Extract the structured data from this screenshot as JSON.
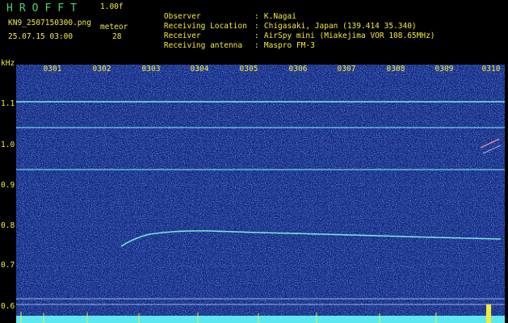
{
  "header": {
    "logo": "HROFFT",
    "version": "1.00f",
    "filename": "KN9_2507150300.png",
    "meteor_label": "meteor",
    "meteor_count": "28",
    "datetime": "25.07.15 03:00"
  },
  "info": [
    {
      "key": "Observer",
      "sep": ":",
      "value": "K.Nagai"
    },
    {
      "key": "Receiving Location",
      "sep": ":",
      "value": "Chigasaki, Japan (139.414 35.340)"
    },
    {
      "key": "Receiver",
      "sep": ":",
      "value": "AirSpy mini (Miakejima VOR 108.65MHz)"
    },
    {
      "key": "Receiving antenna",
      "sep": ":",
      "value": "Maspro FM-3"
    }
  ],
  "axis": {
    "y_unit": "kHz",
    "y_ticks": [
      "1.1",
      "1.0",
      "0.9",
      "0.8",
      "0.7",
      "0.6"
    ],
    "x_ticks": [
      "0301",
      "0302",
      "0303",
      "0304",
      "0305",
      "0306",
      "0307",
      "0308",
      "0309",
      "0310"
    ]
  },
  "colors": {
    "background": "#14287e",
    "label": "#f4ec3a",
    "title": "#4fd36a",
    "signal": "#7fe6e0"
  }
}
